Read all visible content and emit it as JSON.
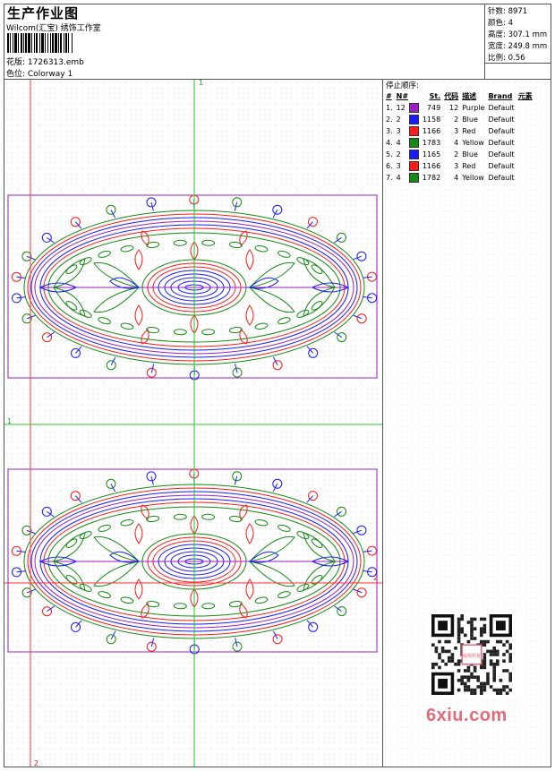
{
  "header": {
    "title": "生产作业图",
    "company": "Wilcom(汇宝) 绣饰工作室",
    "design_label": "花版:",
    "design_file": "1726313.emb",
    "colorway_label": "色位:",
    "colorway": "Colorway 1"
  },
  "stats": {
    "stitches_label": "针数:",
    "stitches": "8971",
    "colors_label": "颜色:",
    "colors": "4",
    "height_label": "高度:",
    "height": "307.1 mm",
    "width_label": "宽度:",
    "width": "249.8 mm",
    "scale_label": "比例:",
    "scale": "0.56"
  },
  "stop_sequence": {
    "title": "停止顺序:",
    "columns": [
      "#",
      "N#",
      "St.",
      "代码",
      "描述",
      "Brand",
      "元素"
    ],
    "rows": [
      {
        "index": "1.",
        "n": "12",
        "color": "#9b1fc1",
        "st": "749",
        "code": "12",
        "desc": "Purple",
        "brand": "Default"
      },
      {
        "index": "2.",
        "n": "2",
        "color": "#1a1aff",
        "st": "1158",
        "code": "2",
        "desc": "Blue",
        "brand": "Default"
      },
      {
        "index": "3.",
        "n": "3",
        "color": "#ff1a1a",
        "st": "1166",
        "code": "3",
        "desc": "Red",
        "brand": "Default"
      },
      {
        "index": "4.",
        "n": "4",
        "color": "#138a13",
        "st": "1783",
        "code": "4",
        "desc": "Yellow",
        "brand": "Default"
      },
      {
        "index": "5.",
        "n": "2",
        "color": "#1a1aff",
        "st": "1165",
        "code": "2",
        "desc": "Blue",
        "brand": "Default"
      },
      {
        "index": "6.",
        "n": "3",
        "color": "#ff1a1a",
        "st": "1166",
        "code": "3",
        "desc": "Red",
        "brand": "Default"
      },
      {
        "index": "7.",
        "n": "4",
        "color": "#138a13",
        "st": "1782",
        "code": "4",
        "desc": "Yellow",
        "brand": "Default"
      }
    ]
  },
  "guides": {
    "vertical_green_label": "1",
    "horizontal_green_label": "1",
    "vertical_red_label": "2",
    "horizontal_red_label": "2"
  },
  "colors": {
    "purple": "#9b1fc1",
    "blue": "#1a1aff",
    "red": "#ff1a1a",
    "green": "#138a13",
    "guide_green": "#22cc22",
    "guide_red": "#ff3333"
  },
  "watermark": {
    "text": "6xiu.com",
    "stamp": "版权所有"
  }
}
